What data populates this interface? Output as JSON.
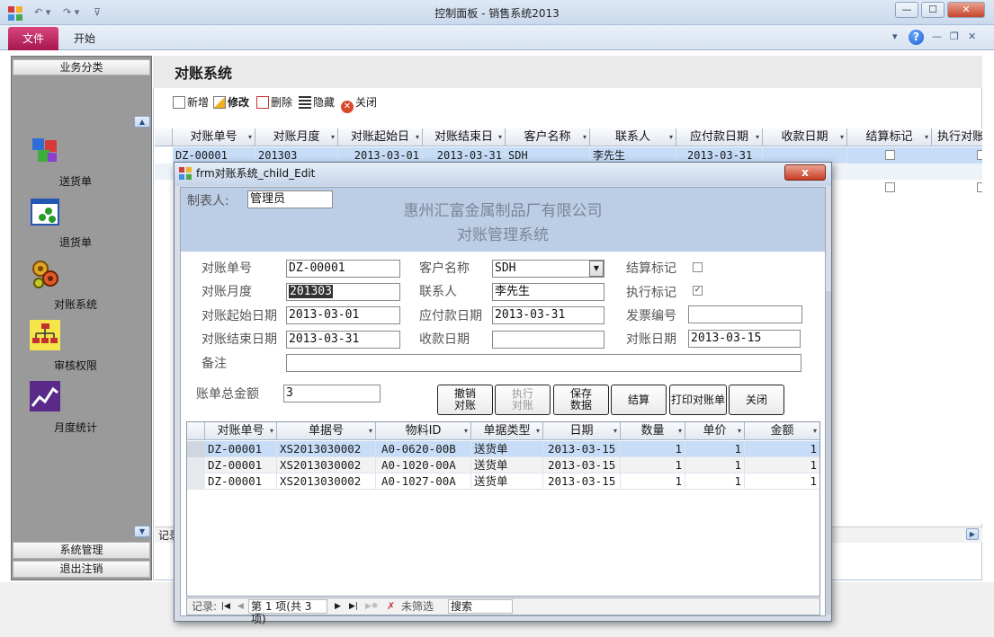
{
  "window": {
    "title": "控制面板 - 销售系统2013"
  },
  "ribbon": {
    "file_tab": "文件",
    "home_tab": "开始"
  },
  "nav": {
    "header": "业务分类",
    "items": [
      {
        "label": "送货单",
        "icon": "cubes-icon"
      },
      {
        "label": "退货单",
        "icon": "window-dots-icon"
      },
      {
        "label": "对账系统",
        "icon": "gears-icon"
      },
      {
        "label": "审核权限",
        "icon": "org-chart-icon"
      },
      {
        "label": "月度统计",
        "icon": "line-chart-icon"
      }
    ],
    "footer": [
      "系统管理",
      "退出注销"
    ]
  },
  "form": {
    "title": "对账系统",
    "toolbar": [
      {
        "label": "新增",
        "icon": "new-doc-icon"
      },
      {
        "label": "修改",
        "icon": "edit-icon"
      },
      {
        "label": "删除",
        "icon": "delete-icon"
      },
      {
        "label": "隐藏",
        "icon": "hide-icon"
      },
      {
        "label": "关闭",
        "icon": "close-circle-icon"
      }
    ],
    "grid": {
      "columns": [
        "对账单号",
        "对账月度",
        "对账起始日",
        "对账结束日",
        "客户名称",
        "联系人",
        "应付款日期",
        "收款日期",
        "结算标记",
        "执行对账"
      ],
      "row1": [
        "DZ-00001",
        "201303",
        "2013-03-01",
        "2013-03-31",
        "SDH",
        "李先生",
        "2013-03-31",
        ""
      ],
      "checks": [
        false,
        true,
        false
      ],
      "footer_label": "记录"
    }
  },
  "modal": {
    "title": "frm对账系统_child_Edit",
    "close_label": "x",
    "company": "惠州汇富金属制品厂有限公司",
    "system": "对账管理系统",
    "maker_label": "制表人:",
    "maker_value": "管理员",
    "fields": {
      "bill_no": {
        "label": "对账单号",
        "value": "DZ-00001"
      },
      "month": {
        "label": "对账月度",
        "value": "201303"
      },
      "start": {
        "label": "对账起始日期",
        "value": "2013-03-01"
      },
      "end": {
        "label": "对账结束日期",
        "value": "2013-03-31"
      },
      "remark": {
        "label": "备注",
        "value": ""
      },
      "customer": {
        "label": "客户名称",
        "value": "SDH"
      },
      "contact": {
        "label": "联系人",
        "value": "李先生"
      },
      "due": {
        "label": "应付款日期",
        "value": "2013-03-31"
      },
      "receive": {
        "label": "收款日期",
        "value": ""
      },
      "settle": {
        "label": "结算标记",
        "checked": false
      },
      "execute": {
        "label": "执行标记",
        "checked": true
      },
      "invoice": {
        "label": "发票编号",
        "value": ""
      },
      "recon_date": {
        "label": "对账日期",
        "value": "2013-03-15"
      },
      "total": {
        "label": "账单总金额",
        "value": "3"
      }
    },
    "buttons": {
      "cancel": [
        "撤销",
        "对账"
      ],
      "execute": [
        "执行",
        "对账"
      ],
      "save": [
        "保存",
        "数据"
      ],
      "settle": "结算",
      "print": "打印对账单",
      "close": "关闭"
    },
    "subgrid": {
      "columns": [
        "对账单号",
        "单据号",
        "物料ID",
        "单据类型",
        "日期",
        "数量",
        "单价",
        "金额"
      ],
      "rows": [
        [
          "DZ-00001",
          "XS2013030002",
          "A0-0620-00B",
          "送货单",
          "2013-03-15",
          "1",
          "1",
          "1"
        ],
        [
          "DZ-00001",
          "XS2013030002",
          "A0-1020-00A",
          "送货单",
          "2013-03-15",
          "1",
          "1",
          "1"
        ],
        [
          "DZ-00001",
          "XS2013030002",
          "A0-1027-00A",
          "送货单",
          "2013-03-15",
          "1",
          "1",
          "1"
        ]
      ]
    },
    "recnav": {
      "label": "记录:",
      "position": "第 1 项(共 3 项)",
      "filter": "未筛选",
      "search": "搜索"
    }
  },
  "colors": {
    "file_tab": "#b81d5a",
    "selected_row": "#c6dcf7",
    "header_band": "#bccde6"
  }
}
